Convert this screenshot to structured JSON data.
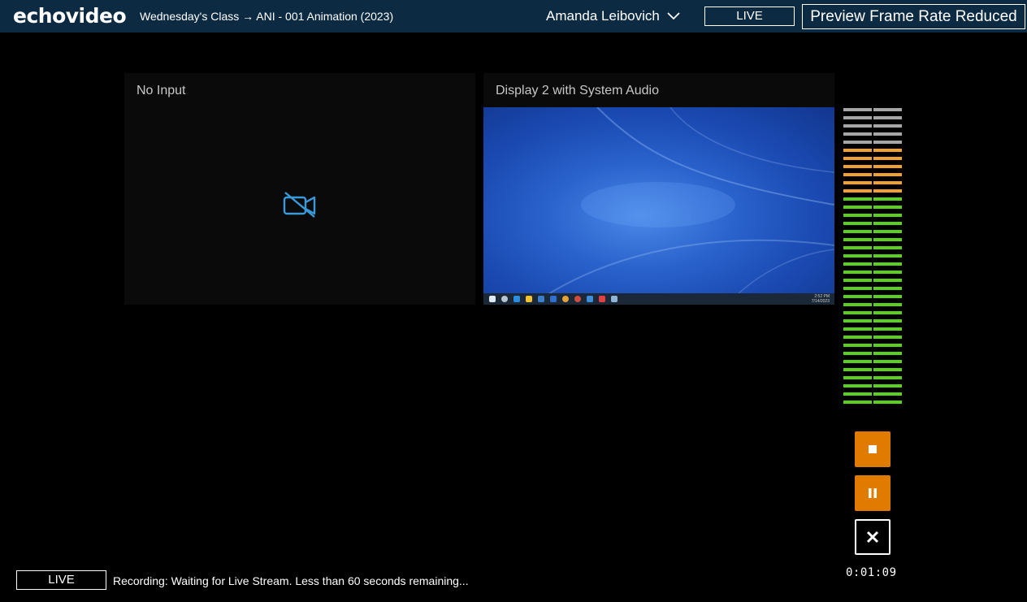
{
  "header": {
    "logo": "echovideo",
    "breadcrumb": "Wednesday's Class → ANI - 001 Animation (2023)",
    "user_name": "Amanda Leibovich",
    "live_label": "LIVE",
    "preview_badge": "Preview Frame Rate Reduced"
  },
  "sources": [
    {
      "title": "No Input",
      "icon": "camera-off-icon"
    },
    {
      "title": "Display 2 with System Audio",
      "clock": [
        "2:52 PM",
        "7/14/2023"
      ]
    }
  ],
  "audio_meter": {
    "channels": 2,
    "segments": 37,
    "level": 1.0,
    "colors": {
      "low": "#5ad01e",
      "mid": "#f0a030",
      "high": "#a6a6a6"
    }
  },
  "controls": {
    "stop_icon": "stop-icon",
    "pause_icon": "pause-icon",
    "cancel_icon": "close-icon",
    "timer": "0:01:09"
  },
  "status": {
    "live_label": "LIVE",
    "message": "Recording: Waiting for Live Stream. Less than 60 seconds remaining..."
  },
  "colors": {
    "header_bg": "#0c2a42",
    "accent_orange": "#e07b00",
    "icon_blue": "#3a9ad9"
  }
}
